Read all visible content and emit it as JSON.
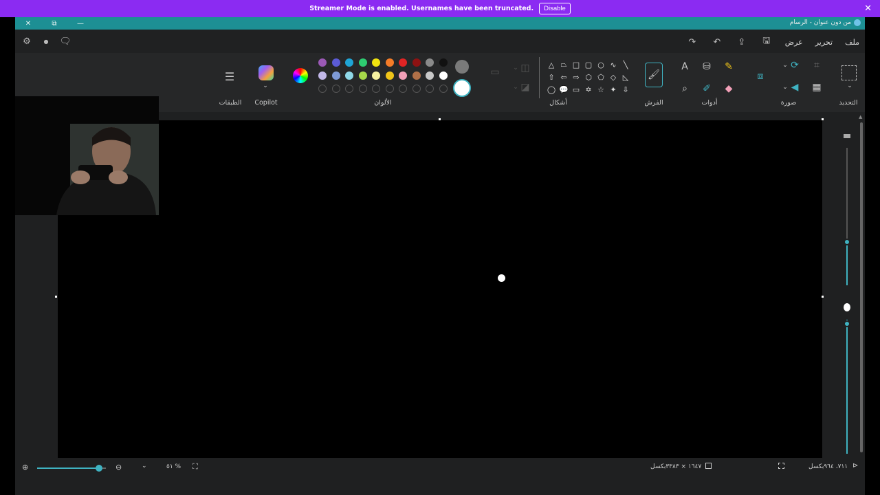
{
  "banner": {
    "message": "Streamer Mode is enabled. Usernames have been truncated.",
    "disable_label": "Disable",
    "close_icon": "close-icon",
    "color": "#8b2bf2"
  },
  "window": {
    "title": "من دون عنوان - الرسام",
    "accent": "#1d8f94"
  },
  "menu": {
    "items": [
      "ملف",
      "تحرير",
      "عرض"
    ]
  },
  "ribbon": {
    "groups": {
      "selection": "التحديد",
      "image": "صورة",
      "tools": "أدوات",
      "brushes": "الفرش",
      "shapes": "أشكال",
      "colors": "الألوان",
      "copilot": "Copilot",
      "layers": "الطبقات"
    },
    "colors_row1": [
      "#9b59b6",
      "#5b5bd6",
      "#1fa5d6",
      "#2ecc71",
      "#f1e30f",
      "#f57c28",
      "#e02424",
      "#8e1212",
      "#8a8a8a",
      "#111111"
    ],
    "colors_row2": [
      "#c2b8e8",
      "#7e9ad6",
      "#8fd8e8",
      "#a6d84a",
      "#f6f1a0",
      "#f0c419",
      "#f2a0b8",
      "#b07048",
      "#c8c8c8",
      "#ffffff"
    ],
    "active_color_1": "#7a7a7a",
    "active_color_2": "#ffffff"
  },
  "status": {
    "cursor_position": "٧١١، ٩٦٤بكسل",
    "canvas_size": "١٦٤٧ × ٣٣٨٣بكسل",
    "zoom": "٥١ %",
    "zoom_level": 0.9
  }
}
